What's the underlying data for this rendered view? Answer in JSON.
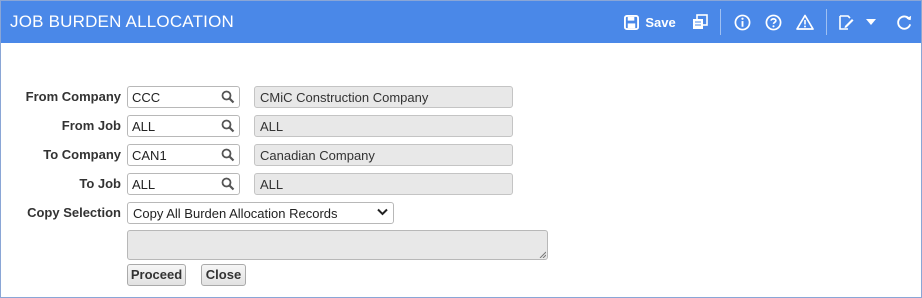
{
  "window": {
    "title": "JOB BURDEN ALLOCATION",
    "save_label": "Save",
    "toolbar_icons": [
      "save-icon",
      "copy-icon",
      "info-icon",
      "help-icon",
      "warning-icon",
      "edit-icon",
      "dropdown-caret-icon",
      "refresh-icon"
    ]
  },
  "form": {
    "from_company": {
      "label": "From Company",
      "value": "CCC",
      "description": "CMiC Construction Company"
    },
    "from_job": {
      "label": "From Job",
      "value": "ALL",
      "description": "ALL"
    },
    "to_company": {
      "label": "To Company",
      "value": "CAN1",
      "description": "Canadian Company"
    },
    "to_job": {
      "label": "To Job",
      "value": "ALL",
      "description": "ALL"
    },
    "copy_selection": {
      "label": "Copy Selection",
      "value": "Copy All Burden Allocation Records"
    },
    "message": ""
  },
  "buttons": {
    "proceed": "Proceed",
    "close": "Close"
  },
  "colors": {
    "header": "#4a88e8",
    "readonly_bg": "#e8e8e8"
  }
}
